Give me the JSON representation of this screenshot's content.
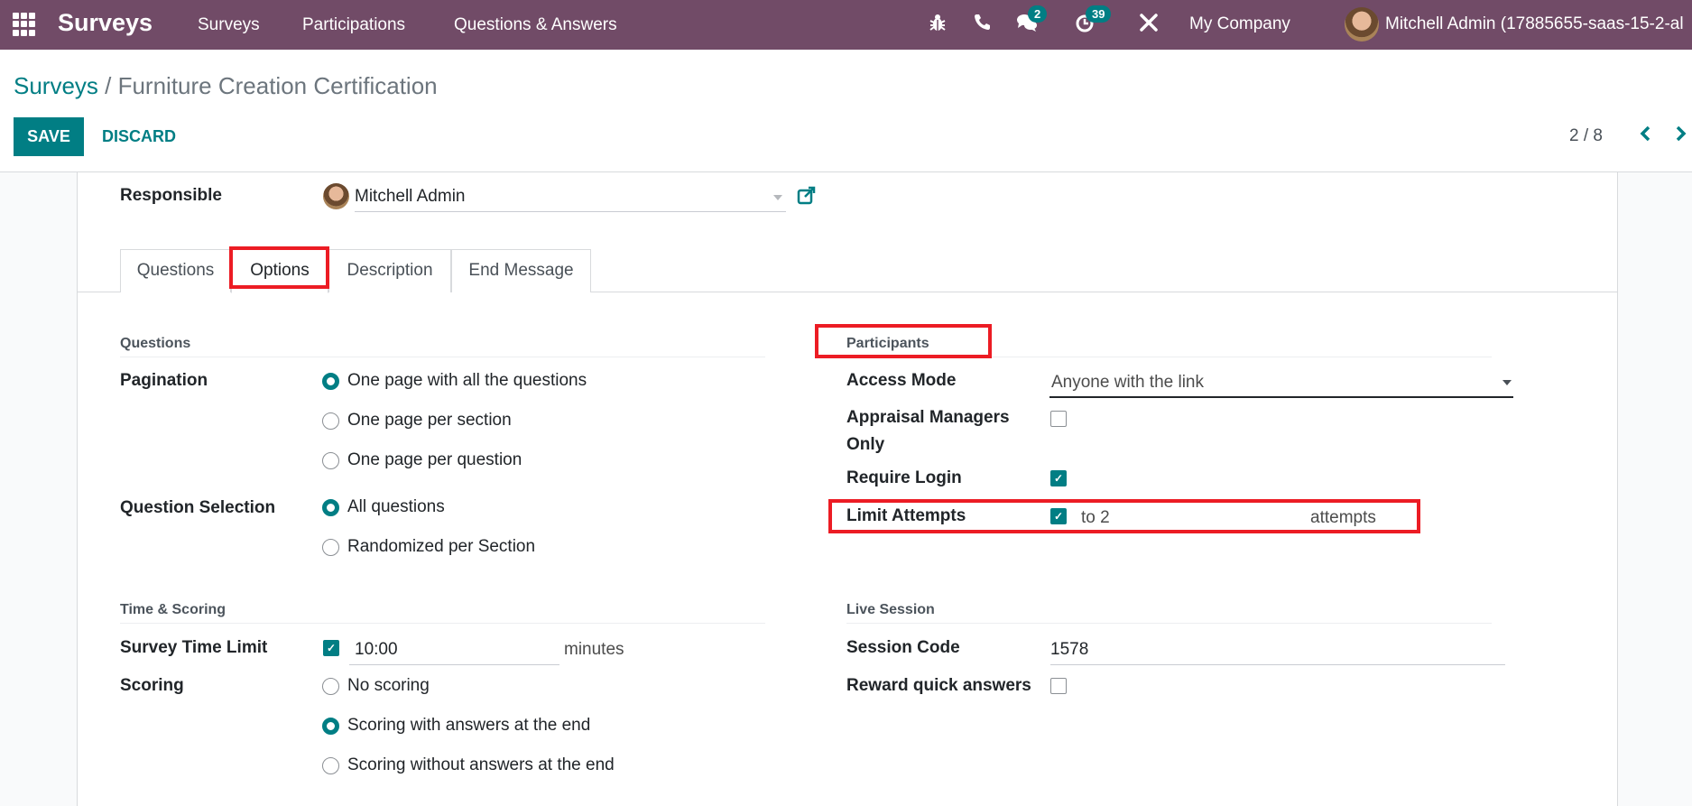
{
  "navbar": {
    "brand": "Surveys",
    "menu": [
      "Surveys",
      "Participations",
      "Questions & Answers"
    ],
    "icons": {
      "debug": "bug-icon",
      "phone": "phone-icon",
      "messages": "chat-icon",
      "activities": "clock-icon",
      "tools": "tools-icon"
    },
    "messages_count": "2",
    "activities_count": "39",
    "company": "My Company",
    "user": "Mitchell Admin (17885655-saas-15-2-al"
  },
  "control_panel": {
    "breadcrumb_parent": "Surveys",
    "breadcrumb_separator": " / ",
    "breadcrumb_current": "Furniture Creation Certification",
    "save_label": "SAVE",
    "discard_label": "DISCARD",
    "pager": "2 / 8",
    "prev": "‹",
    "next": "›"
  },
  "form": {
    "responsible_label": "Responsible",
    "responsible_value": "Mitchell Admin",
    "tabs": [
      "Questions",
      "Options",
      "Description",
      "End Message"
    ],
    "active_tab": "Options",
    "questions_section": {
      "title": "Questions",
      "pagination_label": "Pagination",
      "pagination_options": [
        "One page with all the questions",
        "One page per section",
        "One page per question"
      ],
      "pagination_selected": "One page with all the questions",
      "selection_label": "Question Selection",
      "selection_options": [
        "All questions",
        "Randomized per Section"
      ],
      "selection_selected": "All questions"
    },
    "time_scoring_section": {
      "title": "Time & Scoring",
      "time_limit_label": "Survey Time Limit",
      "time_limit_checked": true,
      "time_limit_value": "10:00",
      "time_limit_unit": "minutes",
      "scoring_label": "Scoring",
      "scoring_options": [
        "No scoring",
        "Scoring with answers at the end",
        "Scoring without answers at the end"
      ],
      "scoring_selected": "Scoring with answers at the end"
    },
    "participants_section": {
      "title": "Participants",
      "access_mode_label": "Access Mode",
      "access_mode_value": "Anyone with the link",
      "appraisal_label_line1": "Appraisal Managers",
      "appraisal_label_line2": "Only",
      "appraisal_checked": false,
      "require_login_label": "Require Login",
      "require_login_checked": true,
      "limit_attempts_label": "Limit Attempts",
      "limit_attempts_checked": true,
      "limit_attempts_value": "to 2",
      "limit_attempts_unit": "attempts"
    },
    "live_session_section": {
      "title": "Live Session",
      "session_code_label": "Session Code",
      "session_code_value": "1578",
      "reward_label": "Reward quick answers",
      "reward_checked": false
    }
  },
  "colors": {
    "navbar": "#714b67",
    "accent": "#017e84",
    "highlight": "#ec1c24"
  }
}
